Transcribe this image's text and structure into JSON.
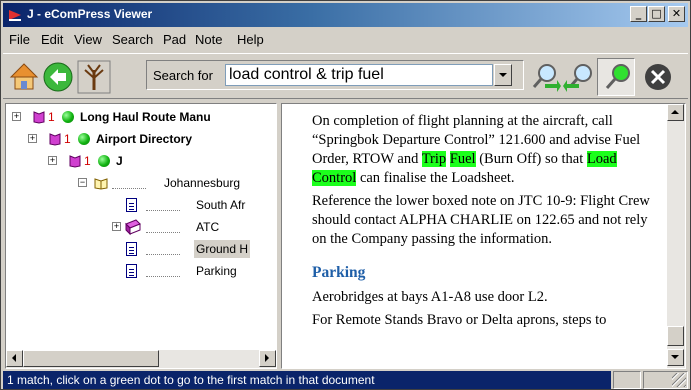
{
  "window": {
    "title": "J - eComPress Viewer",
    "min_glyph": "_",
    "max_glyph": "□",
    "close_glyph": "✕"
  },
  "menu": [
    "File",
    "Edit",
    "View",
    "Search",
    "Pad",
    "Note",
    "Help"
  ],
  "toolbar": {
    "search_label": "Search for",
    "search_value": "load control & trip fuel",
    "icons": [
      "home-icon",
      "back-arrow-icon",
      "tree-icon",
      "search-forward-icon",
      "search-back-icon",
      "search-green-icon",
      "cancel-icon"
    ]
  },
  "tree": {
    "items": [
      {
        "label": "Long Haul Route Manu",
        "count": "1",
        "bold": true,
        "expander": "+"
      },
      {
        "label": "Airport Directory",
        "count": "1",
        "bold": true,
        "expander": "+"
      },
      {
        "label": "J",
        "count": "1",
        "bold": true,
        "expander": "+"
      },
      {
        "label": "Johannesburg",
        "expander": "−"
      },
      {
        "label": "South Afr"
      },
      {
        "label": "ATC",
        "expander": "+"
      },
      {
        "label": "Ground H"
      },
      {
        "label": "Parking"
      }
    ]
  },
  "content": {
    "p1_a": "On completion of flight planning at the aircraft, call “Springbok Departure Control” 121.600 and advise Fuel Order, RTOW and ",
    "hl_trip": "Trip",
    "hl_fuel": "Fuel",
    "p1_b": " (Burn Off) so that ",
    "hl_load": "Load",
    "hl_control": "Control",
    "p1_c": " can finalise the Loadsheet.",
    "p2": "Reference the lower boxed note on JTC 10-9: Flight Crew should contact ALPHA CHARLIE on 122.65 and not rely on the Company passing the information.",
    "section_heading": "Parking",
    "p3": "Aerobridges at bays A1-A8 use door L2.",
    "p4": "For Remote Stands Bravo or Delta aprons, steps to"
  },
  "status": {
    "message": "1 match, click on a green dot to go to the first match in that document"
  },
  "colors": {
    "highlight": "#1cff1c",
    "heading": "#1f5fa8",
    "status_bg": "#0a246a"
  }
}
